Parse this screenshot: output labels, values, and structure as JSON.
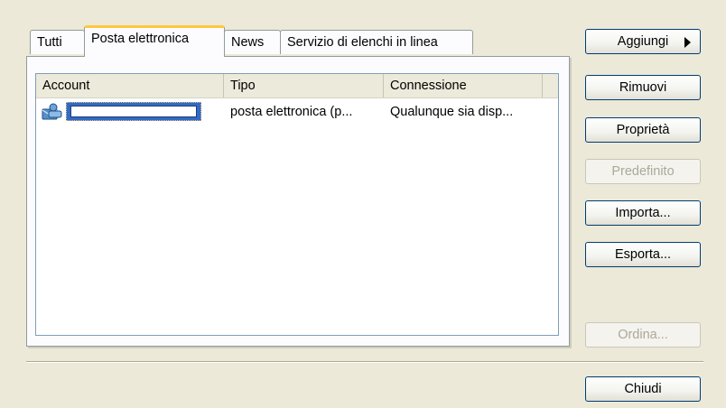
{
  "tabs": [
    {
      "label": "Tutti",
      "active": false
    },
    {
      "label": "Posta elettronica",
      "active": true
    },
    {
      "label": "News",
      "active": false
    },
    {
      "label": "Servizio di elenchi in linea",
      "active": false
    }
  ],
  "list": {
    "columns": [
      "Account",
      "Tipo",
      "Connessione"
    ],
    "rows": [
      {
        "account": "",
        "type": "posta elettronica (p...",
        "connection": "Qualunque sia disp..."
      }
    ]
  },
  "buttons": {
    "add": "Aggiungi",
    "remove": "Rimuovi",
    "properties": "Proprietà",
    "default": "Predefinito",
    "import": "Importa...",
    "export": "Esporta...",
    "order": "Ordina...",
    "close": "Chiudi"
  },
  "icons": {
    "account": "mail-account-icon",
    "submenu": "submenu-arrow-icon"
  },
  "colors": {
    "active_tab_accent": "#ffc83c",
    "selection": "#316ac5",
    "button_border": "#003c74",
    "disabled_text": "#aca899"
  }
}
